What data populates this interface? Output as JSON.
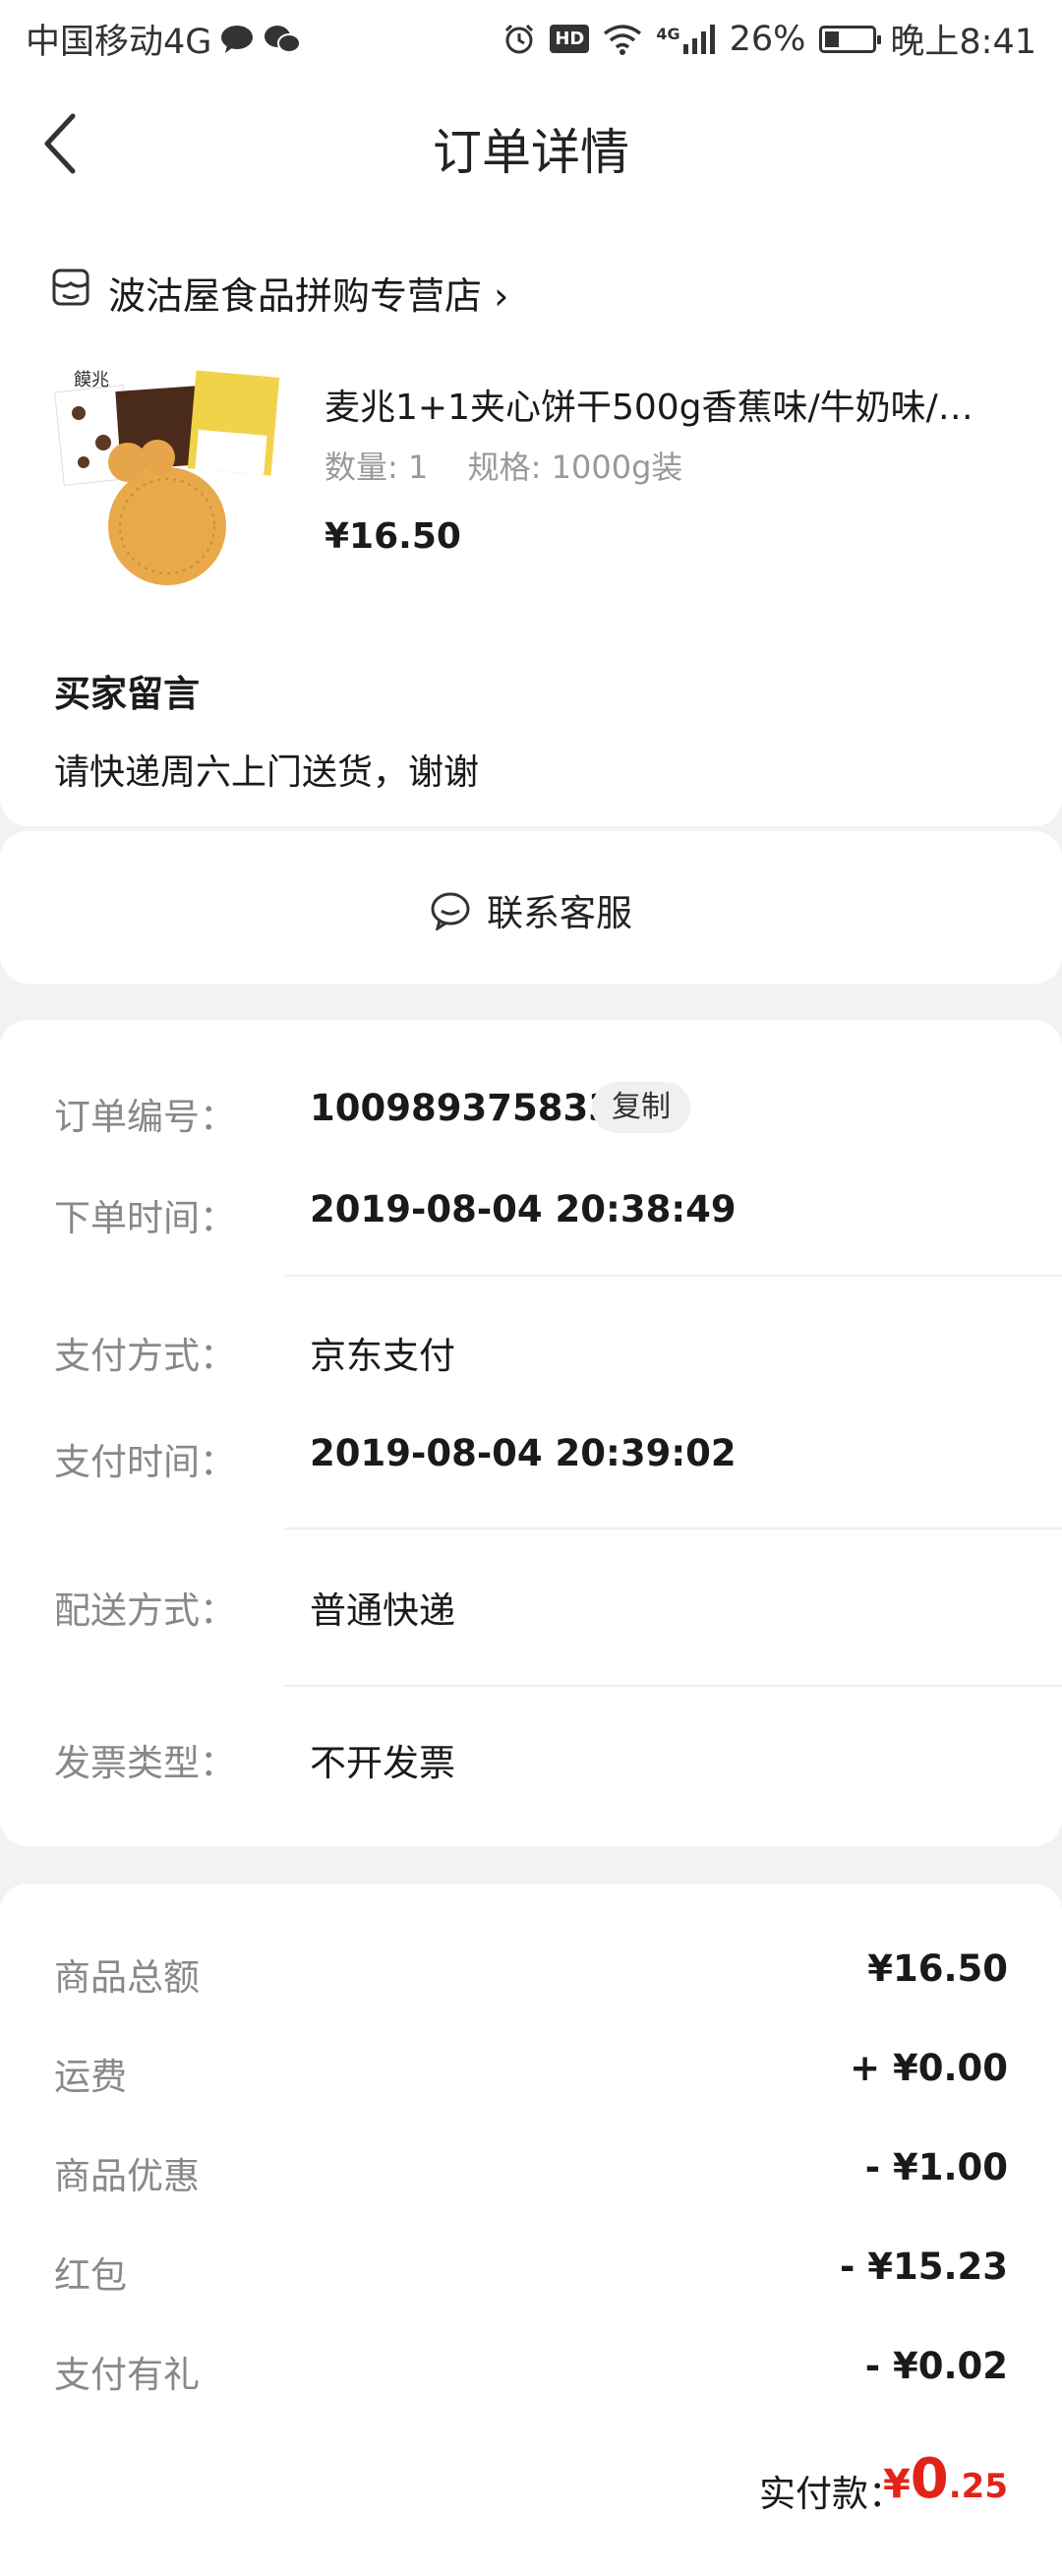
{
  "status_bar": {
    "carrier": "中国移动4G",
    "battery": "26%",
    "time": "晚上8:41",
    "hd": "HD",
    "network": "4G"
  },
  "header": {
    "title": "订单详情"
  },
  "shop": {
    "name": "波沽屋食品拼购专营店 ›"
  },
  "product": {
    "title": "麦兆1+1夹心饼干500g香蕉味/牛奶味/…",
    "quantity": "数量: 1",
    "spec": "规格: 1000g装",
    "price": "¥16.50",
    "image_brand": "饃兆"
  },
  "buyer_message": {
    "label": "买家留言",
    "text": "请快递周六上门送货，谢谢"
  },
  "customer_service": {
    "label": "联系客服"
  },
  "order_info": {
    "order_no_label": "订单编号：",
    "order_no": "100989375833",
    "copy_label": "复制",
    "order_time_label": "下单时间：",
    "order_time": "2019-08-04 20:38:49",
    "pay_method_label": "支付方式：",
    "pay_method": "京东支付",
    "pay_time_label": "支付时间：",
    "pay_time": "2019-08-04 20:39:02",
    "delivery_label": "配送方式：",
    "delivery": "普通快递",
    "invoice_label": "发票类型：",
    "invoice": "不开发票"
  },
  "fees": [
    {
      "label": "商品总额",
      "value": "¥16.50"
    },
    {
      "label": "运费",
      "value": "+ ¥0.00"
    },
    {
      "label": "商品优惠",
      "value": "- ¥1.00"
    },
    {
      "label": "红包",
      "value": "- ¥15.23"
    },
    {
      "label": "支付有礼",
      "value": "- ¥0.02"
    }
  ],
  "total": {
    "label": "实付款：",
    "symbol": "¥",
    "integer": "0",
    "decimal": ".25"
  },
  "colors": {
    "price_red": "#e2231a",
    "background": "#f2f2f2"
  }
}
